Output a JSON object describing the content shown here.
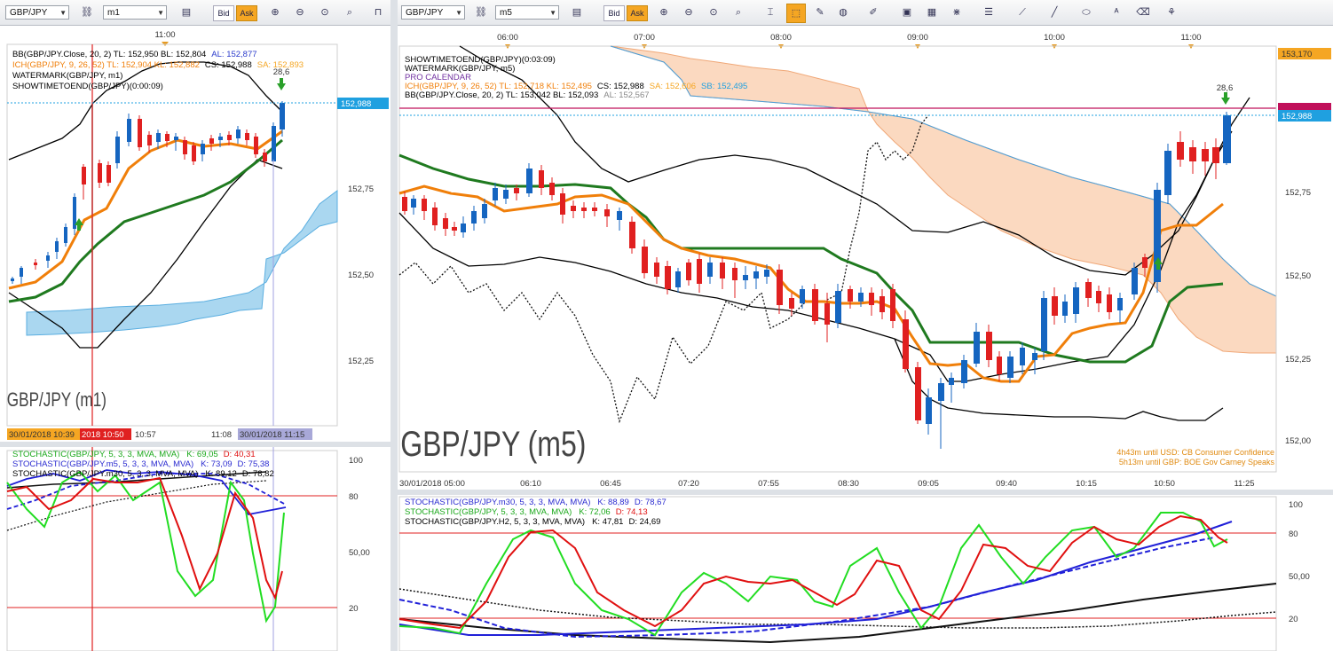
{
  "left_toolbar": {
    "symbol": "GBP/JPY",
    "timeframe": "m1",
    "bid_label": "Bid",
    "ask_label": "Ask"
  },
  "right_toolbar": {
    "symbol": "GBP/JPY",
    "timeframe": "m5",
    "bid_label": "Bid",
    "ask_label": "Ask"
  },
  "icons": [
    "link-icon",
    "chart-type-icon",
    "zoom-in-icon",
    "zoom-out-icon",
    "zoom-fit-icon",
    "crosshair-icon",
    "cursor-icon",
    "globe-icon",
    "ruler-icon",
    "image-icon",
    "template-icon",
    "fib-icon",
    "lines-icon",
    "trendline-icon",
    "ellipse-icon",
    "text-icon",
    "eraser-icon",
    "objects-icon"
  ],
  "colors": {
    "up": "#1565c0",
    "down": "#e02020",
    "ich_tenkan": "#f07f0a",
    "ich_kijun": "#1f7a1f",
    "bb": "#000000",
    "cloud_bull": "#aad7f0",
    "cloud_bear": "#fbd9c0",
    "stoch_green": "#22dd22",
    "stoch_red": "#e01010",
    "stoch_blue": "#2020d8",
    "price_tag": "#1fa0e0",
    "level_line": "#c0105a"
  },
  "m1": {
    "time_header": "11:00",
    "legend": [
      {
        "text": "BB(GBP/JPY.Close, 20, 2)  TL: 152,950  BL: 152,804",
        "extra": "AL: 152,877",
        "extra_color": "#2a3acb"
      },
      {
        "text": "ICH(GBP/JPY, 9, 26, 52)  TL: 152,904  KL: 152,882",
        "prefix_color": "#f07f0a",
        "mid": "CS: 152,988",
        "extra": "SA: 152,893",
        "extra_color": "#f5a623"
      },
      {
        "text": "WATERMARK(GBP/JPY, m1)"
      },
      {
        "text": "SHOWTIMETOEND(GBP/JPY)(0:00:09)"
      }
    ],
    "arrow_label": "28,6",
    "price_tag": "152,988",
    "price_labels": [
      "152,75",
      "152,50",
      "152,25"
    ],
    "watermark": "GBP/JPY (m1)",
    "time_labels": [
      "10:57",
      "11:08"
    ],
    "date_tag_1": "30/01/2018 10:39",
    "date_tag_2": "2018 10:50",
    "date_tag_3": "30/01/2018 11:15",
    "stoch_legend": [
      {
        "text": "STOCHASTIC(GBP/JPY, 5, 3, 3, MVA, MVA)",
        "k": "K: 69,05",
        "d": "D: 40,31",
        "color": "#1aa81a"
      },
      {
        "text": "STOCHASTIC(GBP/JPY.m5, 5, 3, 3, MVA, MVA)",
        "k": "K: 73,09",
        "d": "D: 75,38",
        "color": "#2a2ad0"
      },
      {
        "text": "STOCHASTIC(GBP/JPY.m30, 5, 3, 3, MVA, MVA)",
        "k": "K: 89,12",
        "d": "D: 78,82",
        "color": "#111111"
      }
    ],
    "stoch_axis": [
      "100",
      "80",
      "50,00",
      "20"
    ]
  },
  "m5": {
    "time_header": [
      "06:00",
      "07:00",
      "08:00",
      "09:00",
      "10:00",
      "11:00"
    ],
    "legend": [
      {
        "text": "SHOWTIMETOEND(GBP/JPY)(0:03:09)"
      },
      {
        "text": "WATERMARK(GBP/JPY, m5)"
      },
      {
        "text": "PRO CALENDAR"
      },
      {
        "text": "ICH(GBP/JPY, 9, 26, 52)  TL: 152,718  KL: 152,495",
        "mid": "CS: 152,988",
        "extra": "SA: 152,606",
        "extra2": "SB: 152,495"
      },
      {
        "text": "BB(GBP/JPY.Close, 20, 2)  TL: 153,042  BL: 152,093",
        "extra": "AL: 152,567"
      }
    ],
    "arrow_label": "28,6",
    "price_top": "153,170",
    "price_level": "152,988",
    "price_labels": [
      "152,75",
      "152,50",
      "152,25",
      "152,00"
    ],
    "watermark": "GBP/JPY (m5)",
    "calendar": [
      "4h43m until USD: CB Consumer Confidence",
      "5h13m until GBP: BOE Gov Carney Speaks"
    ],
    "time_labels": [
      "30/01/2018 05:00",
      "06:10",
      "06:45",
      "07:20",
      "07:55",
      "08:30",
      "09:05",
      "09:40",
      "10:15",
      "10:50",
      "11:25"
    ],
    "stoch_legend": [
      {
        "text": "STOCHASTIC(GBP/JPY.m30, 5, 3, 3, MVA, MVA)",
        "k": "K: 88,89",
        "d": "D: 78,67",
        "color": "#2a2ad0"
      },
      {
        "text": "STOCHASTIC(GBP/JPY, 5, 3, 3, MVA, MVA)",
        "k": "K: 72,06",
        "d": "D: 74,13",
        "color": "#1aa81a"
      },
      {
        "text": "STOCHASTIC(GBP/JPY.H2, 5, 3, 3, MVA, MVA)",
        "k": "K: 47,81",
        "d": "D: 24,69",
        "color": "#111111"
      }
    ],
    "stoch_axis": [
      "100",
      "80",
      "50,00",
      "20"
    ]
  }
}
